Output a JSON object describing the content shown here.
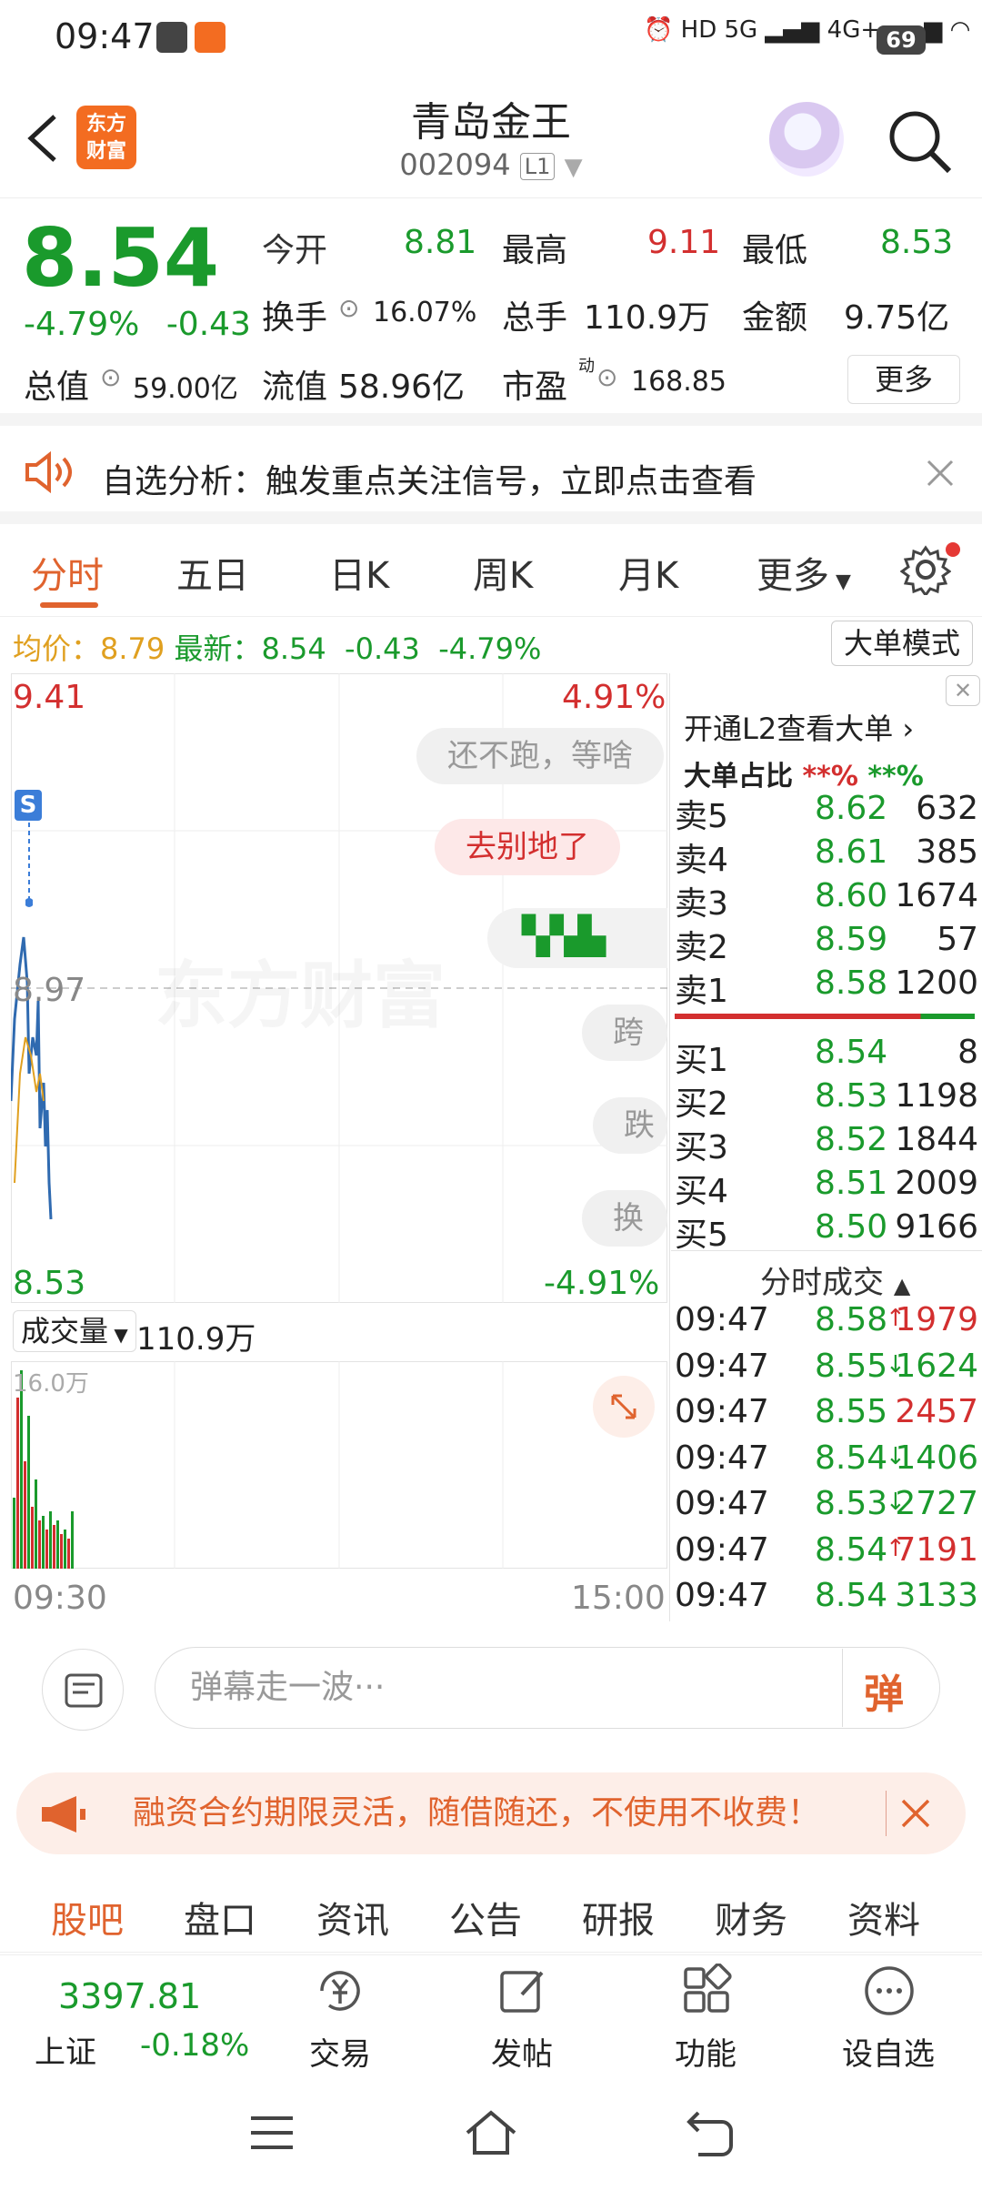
{
  "status": {
    "time": "09:47",
    "battery": "69"
  },
  "header": {
    "logo_line1": "东方",
    "logo_line2": "财富",
    "title": "青岛金王",
    "code": "002094",
    "level": "L1"
  },
  "quote": {
    "price": "8.54",
    "pct": "-4.79%",
    "chg": "-0.43",
    "open_label": "今开",
    "open": "8.81",
    "high_label": "最高",
    "high": "9.11",
    "low_label": "最低",
    "low": "8.53",
    "turnover_label": "换手",
    "turnover": "16.07%",
    "volume_label": "总手",
    "volume": "110.9万",
    "amount_label": "金额",
    "amount": "9.75亿",
    "mcap_label": "总值",
    "mcap": "59.00亿",
    "float_label": "流值",
    "float": "58.96亿",
    "pe_label": "市盈",
    "pe_sup": "动",
    "pe": "168.85",
    "more": "更多"
  },
  "banner": {
    "text": "自选分析：触发重点关注信号，立即点击查看"
  },
  "tabs": [
    "分时",
    "五日",
    "日K",
    "周K",
    "月K",
    "更多"
  ],
  "avgline": {
    "avg_label": "均价：",
    "avg": "8.79",
    "last_label": "最新：",
    "last": "8.54",
    "chg": "-0.43",
    "pct": "-4.79%"
  },
  "big_mode": "大单模式",
  "chart": {
    "y_top": "9.41",
    "y_top_pct": "4.91%",
    "y_mid": "8.97",
    "y_bot": "8.53",
    "y_bot_pct": "-4.91%",
    "watermark": "东方财富",
    "s_marker": "S",
    "bubbles": [
      "还不跑，等啥",
      "去别地了",
      "跨境",
      "跌停",
      "换手"
    ],
    "volume_label": "成交量",
    "volume_value": "110.9万",
    "vol_max": "16.0万",
    "t_start": "09:30",
    "t_end": "15:00"
  },
  "orderbook": {
    "l2_text": "开通L2查看大单",
    "big_label": "大单占比",
    "big_red": "**%",
    "big_green": "**%",
    "asks": [
      {
        "label": "卖5",
        "price": "8.62",
        "vol": "632"
      },
      {
        "label": "卖4",
        "price": "8.61",
        "vol": "385"
      },
      {
        "label": "卖3",
        "price": "8.60",
        "vol": "1674"
      },
      {
        "label": "卖2",
        "price": "8.59",
        "vol": "57"
      },
      {
        "label": "卖1",
        "price": "8.58",
        "vol": "1200"
      }
    ],
    "bids": [
      {
        "label": "买1",
        "price": "8.54",
        "vol": "8"
      },
      {
        "label": "买2",
        "price": "8.53",
        "vol": "1198"
      },
      {
        "label": "买3",
        "price": "8.52",
        "vol": "1844"
      },
      {
        "label": "买4",
        "price": "8.51",
        "vol": "2009"
      },
      {
        "label": "买5",
        "price": "8.50",
        "vol": "9166"
      }
    ],
    "ticks_title": "分时成交",
    "ticks": [
      {
        "time": "09:47",
        "price": "8.58",
        "arrow": "↑",
        "vol": "1979",
        "color": "#d32f2f"
      },
      {
        "time": "09:47",
        "price": "8.55",
        "arrow": "↓",
        "vol": "1624",
        "color": "#1a9a2c"
      },
      {
        "time": "09:47",
        "price": "8.55",
        "arrow": "",
        "vol": "2457",
        "color": "#d32f2f"
      },
      {
        "time": "09:47",
        "price": "8.54",
        "arrow": "↓",
        "vol": "1406",
        "color": "#1a9a2c"
      },
      {
        "time": "09:47",
        "price": "8.53",
        "arrow": "↓",
        "vol": "2727",
        "color": "#1a9a2c"
      },
      {
        "time": "09:47",
        "price": "8.54",
        "arrow": "↑",
        "vol": "7191",
        "color": "#d32f2f"
      },
      {
        "time": "09:47",
        "price": "8.54",
        "arrow": "",
        "vol": "3133",
        "color": "#1a9a2c"
      }
    ]
  },
  "danmu": {
    "placeholder": "弹幕走一波···",
    "send": "弹"
  },
  "promo": {
    "text": "融资合约期限灵活，随借随还，不使用不收费！"
  },
  "subtabs": [
    "股吧",
    "盘口",
    "资讯",
    "公告",
    "研报",
    "财务",
    "资料"
  ],
  "bottom": {
    "index_value": "3397.81",
    "index_name": "上证",
    "index_pct": "-0.18%",
    "trade": "交易",
    "post": "发帖",
    "func": "功能",
    "watch": "设自选"
  },
  "colors": {
    "up": "#d32f2f",
    "down": "#1a9a2c",
    "accent": "#e0632e"
  }
}
